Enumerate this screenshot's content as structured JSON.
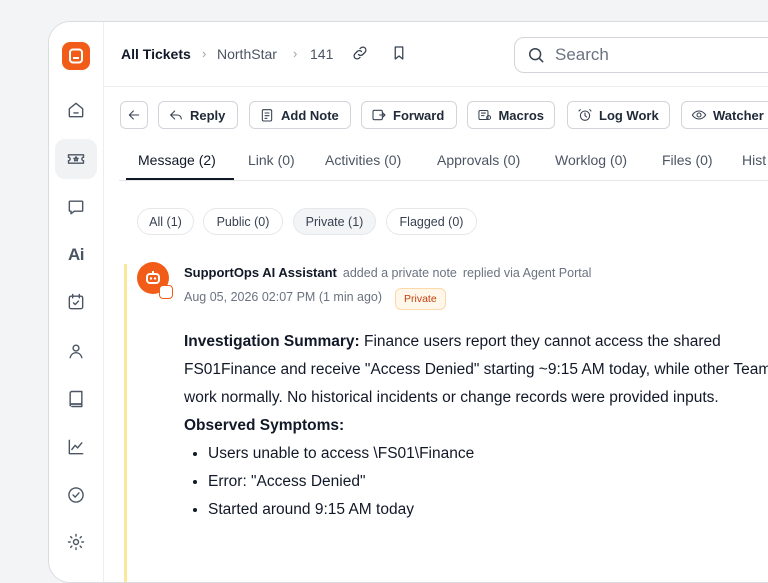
{
  "nav": {
    "items": [
      "home",
      "tickets",
      "chat",
      "ai",
      "calendar-check",
      "contacts",
      "book",
      "analytics",
      "approvals",
      "settings"
    ],
    "ai_label": "Ai"
  },
  "breadcrumb": {
    "root": "All Tickets",
    "org": "NorthStar",
    "ticket": "141"
  },
  "search": {
    "placeholder": "Search"
  },
  "toolbar": {
    "reply": "Reply",
    "add_note": "Add Note",
    "forward": "Forward",
    "macros": "Macros",
    "log_work": "Log Work",
    "watcher": "Watcher"
  },
  "tabs": [
    "Message (2)",
    "Link (0)",
    "Activities (0)",
    "Approvals (0)",
    "Worklog (0)",
    "Files (0)",
    "Hist"
  ],
  "filters": [
    "All (1)",
    "Public (0)",
    "Private (1)",
    "Flagged (0)"
  ],
  "message": {
    "author": "SupportOps AI Assistant",
    "action": "added a private note",
    "channel": "replied via Agent Portal",
    "timestamp": "Aug 05, 2026 02:07 PM (1 min ago)",
    "visibility": "Private",
    "summary_heading": "Investigation Summary:",
    "summary_text": " Finance users report they cannot access the shared FS01Finance and receive \"Access Denied\" starting ~9:15 AM today, while other Teams) work normally. No historical incidents or change records were provided inputs.",
    "symptoms_heading": "Observed Symptoms:",
    "symptoms": [
      "Users unable to access \\FS01\\Finance",
      "Error: \"Access Denied\"",
      "Started around 9:15 AM today"
    ]
  },
  "colors": {
    "brand": "#f25c19",
    "private_note_rail": "#fbe89a",
    "private_badge_text": "#c2410c"
  }
}
